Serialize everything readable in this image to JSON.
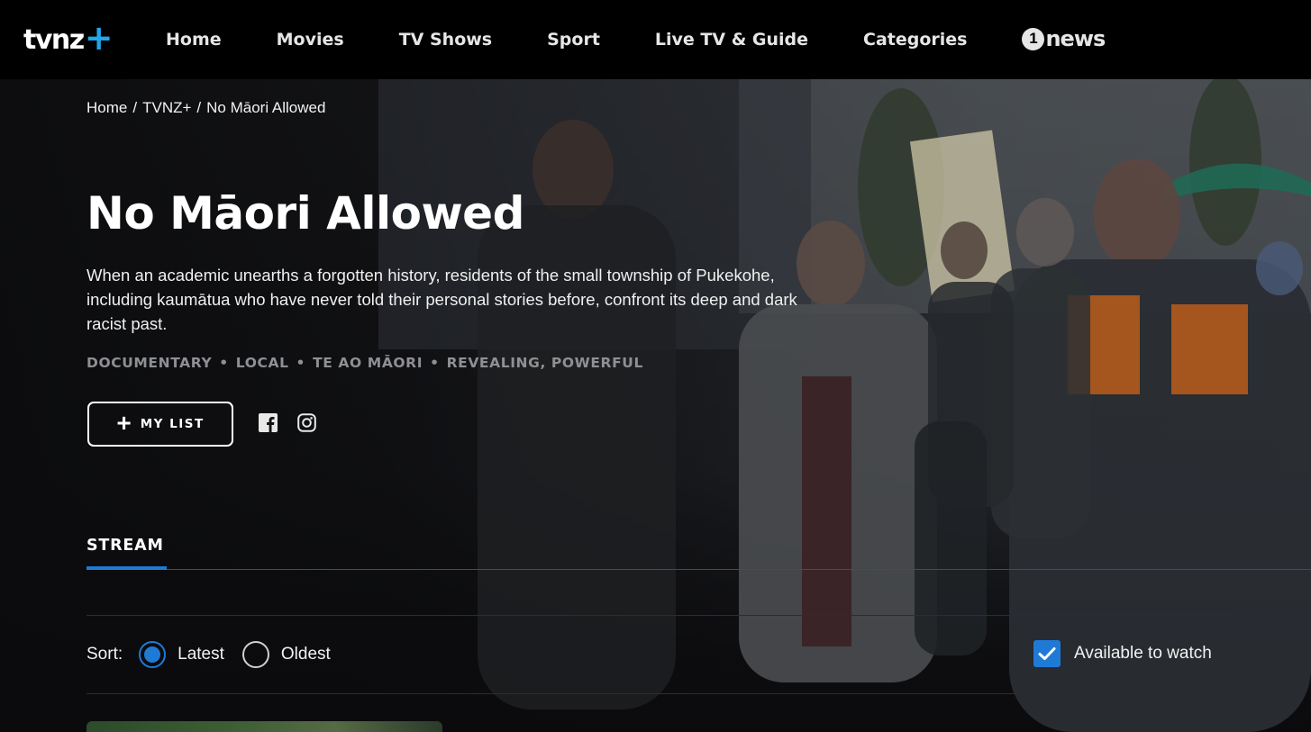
{
  "header": {
    "logo": {
      "text": "tvnz",
      "plus": "+"
    },
    "nav": [
      "Home",
      "Movies",
      "TV Shows",
      "Sport",
      "Live TV & Guide",
      "Categories"
    ],
    "onenews": {
      "digit": "1",
      "word": "news"
    }
  },
  "breadcrumb": {
    "items": [
      "Home",
      "TVNZ+",
      "No Māori Allowed"
    ],
    "separator": "/"
  },
  "show": {
    "title": "No Māori Allowed",
    "description": "When an academic unearths a forgotten history, residents of the small township of Pukekohe, including kaumātua who have never told their personal stories before, confront its deep and dark racist past.",
    "tags": [
      "DOCUMENTARY",
      "LOCAL",
      "TE AO MĀORI",
      "REVEALING, POWERFUL"
    ],
    "tag_separator": "•"
  },
  "actions": {
    "mylist_label": "MY LIST",
    "icons": [
      "plus-icon",
      "facebook-icon",
      "instagram-icon"
    ]
  },
  "tabs": {
    "stream_label": "STREAM"
  },
  "sort": {
    "label": "Sort:",
    "options": [
      "Latest",
      "Oldest"
    ],
    "selected": "Latest"
  },
  "filter": {
    "available_label": "Available to watch",
    "checked": true
  },
  "colors": {
    "accent": "#1f7ad6",
    "logo_plus": "#21a6e8",
    "tag_grey": "#8f9094"
  }
}
